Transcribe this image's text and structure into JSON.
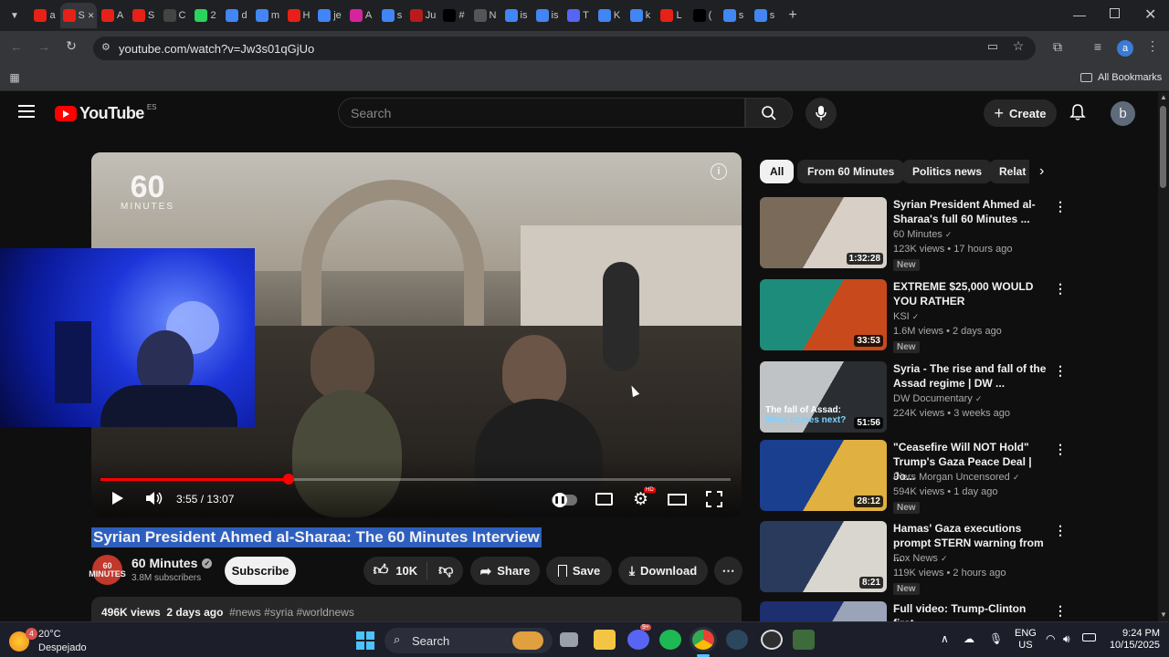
{
  "browser": {
    "url": "youtube.com/watch?v=Jw3s01qGjUo",
    "tabs": [
      {
        "letter": "a",
        "color": "#e62117"
      },
      {
        "letter": "S",
        "color": "#e62117"
      },
      {
        "letter": "A",
        "color": "#e62117"
      },
      {
        "letter": "S",
        "color": "#e62117"
      },
      {
        "letter": "C",
        "color": "#444"
      },
      {
        "letter": "2",
        "color": "#2bd45b"
      },
      {
        "letter": "d",
        "color": "#4285f4"
      },
      {
        "letter": "m",
        "color": "#4285f4"
      },
      {
        "letter": "H",
        "color": "#e62117"
      },
      {
        "letter": "je",
        "color": "#4285f4"
      },
      {
        "letter": "A",
        "color": "#d6249f"
      },
      {
        "letter": "s",
        "color": "#4285f4"
      },
      {
        "letter": "Ju",
        "color": "#b71c1c"
      },
      {
        "letter": "#",
        "color": "#000000"
      },
      {
        "letter": "N",
        "color": "#555"
      },
      {
        "letter": "is",
        "color": "#4285f4"
      },
      {
        "letter": "is",
        "color": "#4285f4"
      },
      {
        "letter": "T",
        "color": "#5865f2"
      },
      {
        "letter": "K",
        "color": "#4285f4"
      },
      {
        "letter": "k",
        "color": "#4285f4"
      },
      {
        "letter": "L",
        "color": "#e62117"
      },
      {
        "letter": "(",
        "color": "#000000"
      },
      {
        "letter": "s",
        "color": "#4285f4"
      },
      {
        "letter": "s",
        "color": "#4285f4"
      }
    ],
    "bookmarks_label": "All Bookmarks",
    "profile_initial": "a"
  },
  "youtube": {
    "logo_text": "YouTube",
    "region": "ES",
    "search_placeholder": "Search",
    "create_label": "Create",
    "avatar_initial": "b",
    "player": {
      "brand_line1": "60",
      "brand_line2": "MINUTES",
      "time": "3:55 / 13:07",
      "progress": 0.299
    },
    "video": {
      "title": "Syrian President Ahmed al-Sharaa: The 60 Minutes Interview",
      "channel": "60 Minutes",
      "channel_logo": "60 MINUTES",
      "subscribers": "3.8M subscribers",
      "subscribe": "Subscribe",
      "likes": "10K",
      "share": "Share",
      "save": "Save",
      "download": "Download",
      "views": "496K views",
      "date": "2 days ago",
      "tags": "#news #syria #worldnews"
    },
    "chips": [
      "All",
      "From 60 Minutes",
      "Politics news",
      "Relat"
    ],
    "recommendations": [
      {
        "title": "Syrian President Ahmed al-Sharaa's full 60 Minutes ...",
        "channel": "60 Minutes",
        "meta": "123K views • 17 hours ago",
        "badge": "New",
        "duration": "1:32:28",
        "c1": "#7a6a5a",
        "c2": "#d8d0c6"
      },
      {
        "title": "EXTREME $25,000 WOULD YOU RATHER",
        "channel": "KSI",
        "meta": "1.6M views • 2 days ago",
        "badge": "New",
        "duration": "33:53",
        "c1": "#1e8c7a",
        "c2": "#c84a1c"
      },
      {
        "title": "Syria - The rise and fall of the Assad regime | DW ...",
        "channel": "DW Documentary",
        "meta": "224K views • 3 weeks ago",
        "badge": "",
        "duration": "51:56",
        "c1": "#bfc3c6",
        "c2": "#2a2d31",
        "overlay1": "The fall of Assad:",
        "overlay2": "What comes next?"
      },
      {
        "title": "\"Ceasefire Will NOT Hold\" Trump's Gaza Peace Deal | Jo...",
        "channel": "Piers Morgan Uncensored",
        "meta": "594K views • 1 day ago",
        "badge": "New",
        "duration": "28:12",
        "c1": "#1a3f8f",
        "c2": "#e0b040"
      },
      {
        "title": "Hamas' Gaza executions prompt STERN warning from ...",
        "channel": "Fox News",
        "meta": "119K views • 2 hours ago",
        "badge": "New",
        "duration": "8:21",
        "c1": "#2a3a5c",
        "c2": "#d9d6cf"
      },
      {
        "title": "Full video: Trump-Clinton first",
        "channel": "",
        "meta": "",
        "badge": "",
        "duration": "",
        "c1": "#1d2f6e",
        "c2": "#9aa3b8"
      }
    ]
  },
  "taskbar": {
    "weather_temp": "20°C",
    "weather_desc": "Despejado",
    "weather_badge": "4",
    "search": "Search",
    "lang1": "ENG",
    "lang2": "US",
    "time": "9:24 PM",
    "date": "10/15/2025",
    "discord_badge": "9+"
  }
}
